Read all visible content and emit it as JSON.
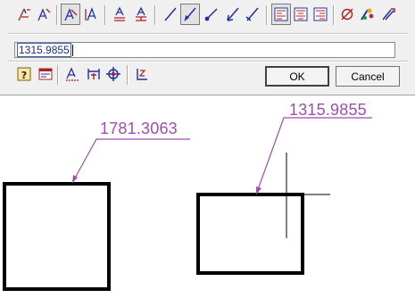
{
  "toolbar_top": {
    "tools": [
      {
        "icon": "linear-dimension-icon",
        "pressed": false
      },
      {
        "icon": "aligned-dimension-icon",
        "pressed": false
      },
      {
        "icon": "angular-text-icon",
        "pressed": true
      },
      {
        "icon": "text-vertical-icon",
        "pressed": false
      },
      {
        "icon": "text-stacked-icon",
        "pressed": false
      },
      {
        "icon": "text-stacked-alt-icon",
        "pressed": false
      },
      {
        "icon": "leader-line-icon",
        "pressed": false
      },
      {
        "icon": "arrow-leader-icon",
        "pressed": true
      },
      {
        "icon": "dot-leader-icon",
        "pressed": false
      },
      {
        "icon": "open-arrow-leader-icon",
        "pressed": false
      },
      {
        "icon": "tick-leader-icon",
        "pressed": false
      },
      {
        "icon": "align-left-icon",
        "pressed": false
      },
      {
        "icon": "align-center-icon",
        "pressed": false
      },
      {
        "icon": "align-right-icon",
        "pressed": false
      },
      {
        "icon": "diameter-symbol-icon",
        "pressed": false
      },
      {
        "icon": "symbol-palette-icon",
        "pressed": false
      },
      {
        "icon": "format-painter-icon",
        "pressed": false
      }
    ]
  },
  "text_editor": {
    "value": "1315.9855"
  },
  "toolbar_bottom": {
    "tools": [
      {
        "icon": "help-icon"
      },
      {
        "icon": "properties-icon"
      },
      {
        "icon": "dimension-style-icon"
      },
      {
        "icon": "ordinate-icon"
      },
      {
        "icon": "snap-target-icon"
      },
      {
        "icon": "baseline-icon"
      }
    ]
  },
  "buttons": {
    "ok_label": "OK",
    "cancel_label": "Cancel"
  },
  "drawing": {
    "left_dimension": "1781.3063",
    "right_dimension": "1315.9855",
    "dimension_color": "#a04cb0",
    "shape_color": "#000000"
  }
}
